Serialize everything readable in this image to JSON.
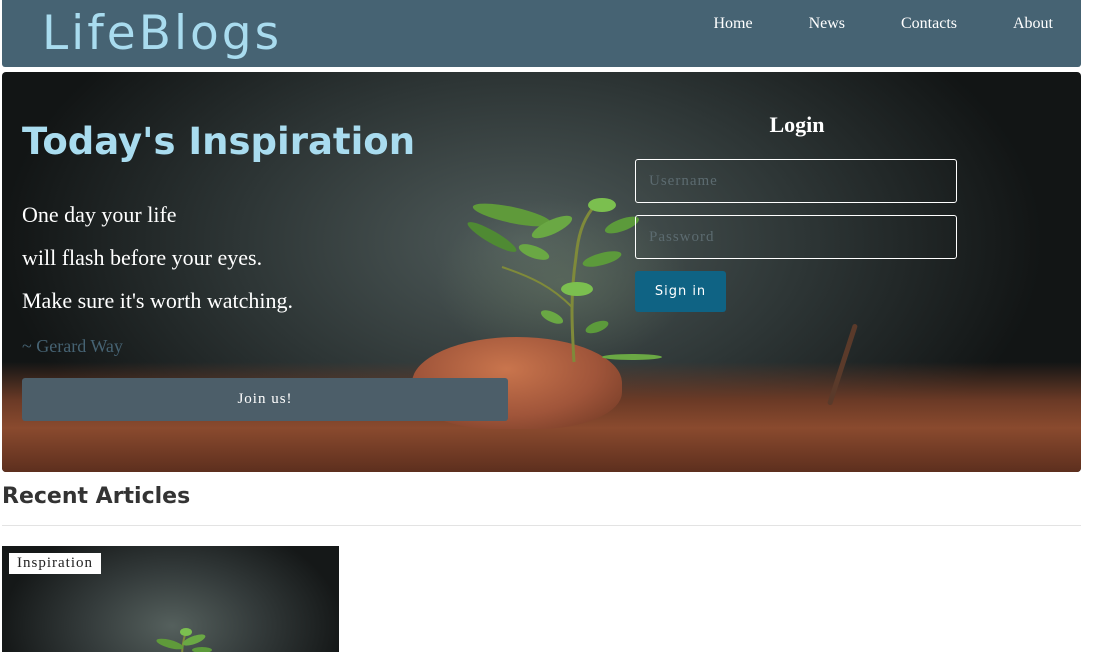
{
  "header": {
    "brand": "LifeBlogs",
    "nav": [
      "Home",
      "News",
      "Contacts",
      "About"
    ]
  },
  "hero": {
    "title": "Today's Inspiration",
    "quote_lines": [
      "One day your life",
      "will flash before your eyes.",
      "Make sure it's worth watching."
    ],
    "author": "~ Gerard Way",
    "join_label": "Join us!"
  },
  "login": {
    "title": "Login",
    "username_placeholder": "Username",
    "password_placeholder": "Password",
    "signin_label": "Sign in"
  },
  "articles": {
    "heading": "Recent Articles",
    "cards": [
      {
        "tag": "Inspiration"
      }
    ]
  },
  "colors": {
    "header_bg": "#466373",
    "brand": "#a9dcef",
    "join_button": "#4c5e69",
    "signin_button": "#0f6384"
  }
}
